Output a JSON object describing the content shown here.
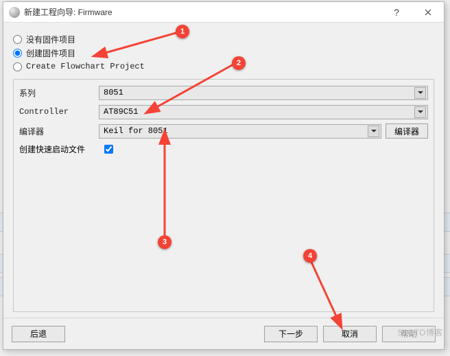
{
  "window": {
    "title": "新建工程向导: Firmware",
    "help_icon": "?",
    "close_icon": "×"
  },
  "radios": {
    "no_firmware": "没有固件项目",
    "create_firmware": "创建固件项目",
    "create_flowchart": "Create Flowchart Project",
    "selected": "create_firmware"
  },
  "form": {
    "series_label": "系列",
    "series_value": "8051",
    "controller_label": "Controller",
    "controller_value": "AT89C51",
    "compiler_label": "编译器",
    "compiler_value": "Keil for 8051",
    "compiler_button": "编译器",
    "quickstart_label": "创建快速启动文件",
    "quickstart_checked": true
  },
  "buttons": {
    "back": "后退",
    "next": "下一步",
    "cancel": "取消",
    "help": "帮助"
  },
  "annotations": {
    "marker1": "1",
    "marker2": "2",
    "marker3": "3",
    "marker4": "4"
  },
  "watermark": "51CTO博客"
}
